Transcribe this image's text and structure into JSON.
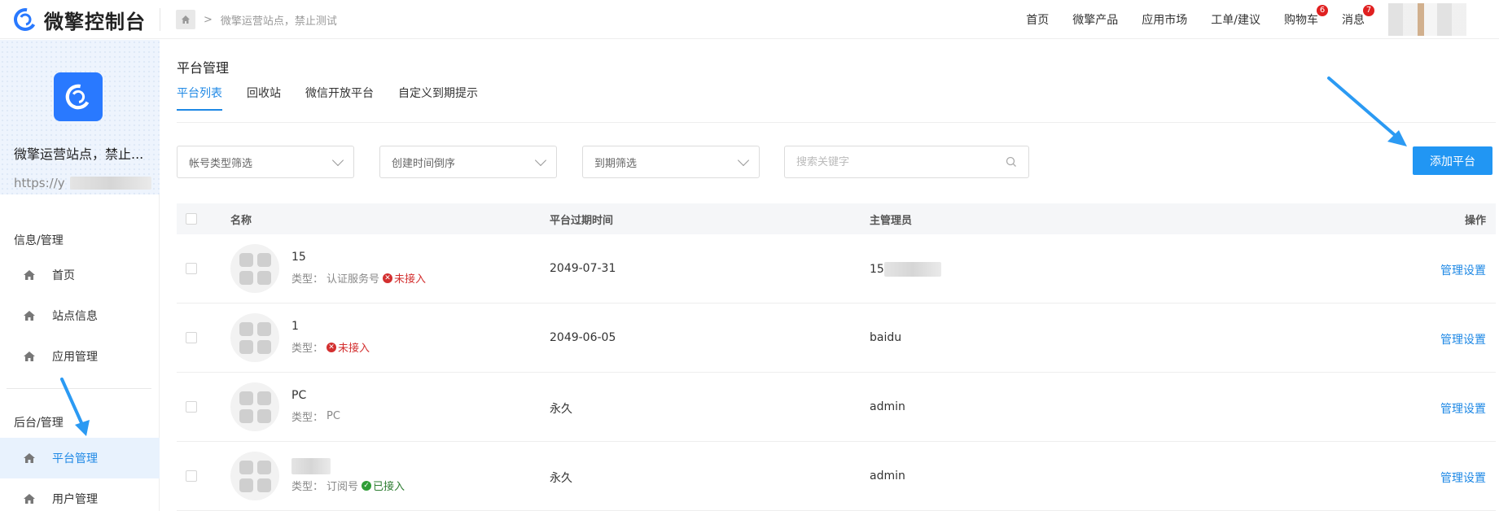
{
  "brand": {
    "name": "微擎控制台",
    "accent": "#2979ff"
  },
  "breadcrumb": {
    "current": "微擎运营站点，禁止测试",
    "separator": ">"
  },
  "topnav": {
    "home": "首页",
    "products": "微擎产品",
    "market": "应用市场",
    "tickets": "工单/建议",
    "cart": "购物车",
    "cart_count": "6",
    "messages": "消息",
    "message_count": "7"
  },
  "sidebar": {
    "site_name": "微擎运营站点，禁止...",
    "site_url": "https://y",
    "group1": "信息/管理",
    "group1_items": [
      "首页",
      "站点信息",
      "应用管理"
    ],
    "group2": "后台/管理",
    "group2_items": [
      "平台管理",
      "用户管理"
    ],
    "active_item": "平台管理"
  },
  "main": {
    "title": "平台管理",
    "tabs": [
      "平台列表",
      "回收站",
      "微信开放平台",
      "自定义到期提示"
    ],
    "active_tab": "平台列表",
    "filters": {
      "account_type": "帐号类型筛选",
      "sort": "创建时间倒序",
      "expiry": "到期筛选",
      "search_placeholder": "搜索关键字"
    },
    "add_button": "添加平台"
  },
  "table": {
    "headers": {
      "name": "名称",
      "expiry": "平台过期时间",
      "admin": "主管理员",
      "op": "操作"
    },
    "type_prefix": "类型：",
    "rows": [
      {
        "title": "15",
        "type": "认证服务号",
        "status": "未接入",
        "status_kind": "off",
        "expiry": "2049-07-31",
        "admin": "15",
        "op": "管理设置"
      },
      {
        "title": "1",
        "type": "",
        "status": "未接入",
        "status_kind": "off",
        "expiry": "2049-06-05",
        "admin": "baidu",
        "op": "管理设置"
      },
      {
        "title": "PC",
        "type": "PC",
        "status": "",
        "status_kind": "none",
        "expiry": "永久",
        "admin": "admin",
        "op": "管理设置"
      },
      {
        "title": "",
        "type": "订阅号",
        "status": "已接入",
        "status_kind": "on",
        "expiry": "永久",
        "admin": "admin",
        "op": "管理设置"
      }
    ]
  }
}
